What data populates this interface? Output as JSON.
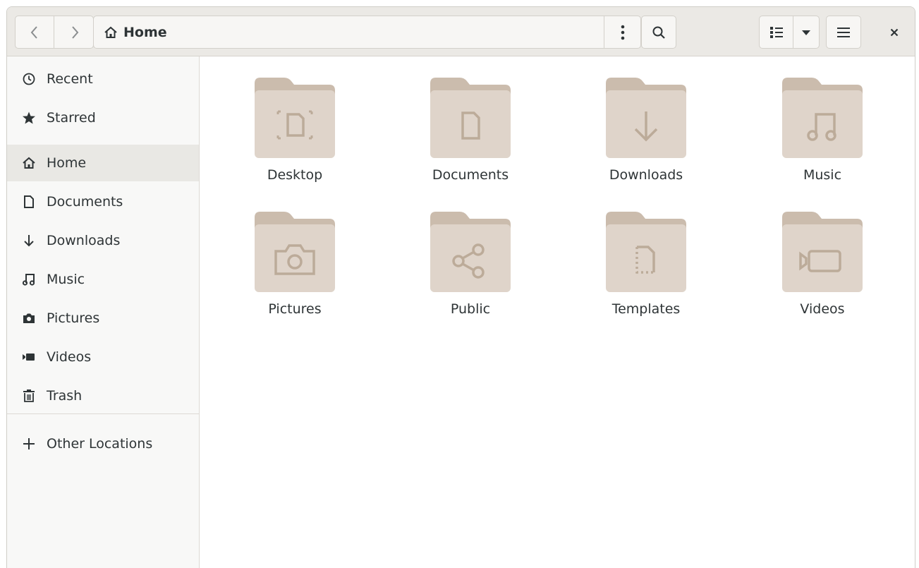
{
  "header": {
    "location_label": "Home",
    "icons": [
      "go-back-icon",
      "go-forward-icon",
      "home-icon",
      "kebab-menu-icon",
      "search-icon",
      "list-view-icon",
      "dropdown-arrow-icon",
      "hamburger-menu-icon",
      "close-icon"
    ]
  },
  "sidebar": {
    "items": [
      {
        "label": "Recent",
        "icon": "clock-icon"
      },
      {
        "label": "Starred",
        "icon": "star-icon"
      },
      {
        "label": "Home",
        "icon": "home-icon"
      },
      {
        "label": "Documents",
        "icon": "document-icon"
      },
      {
        "label": "Downloads",
        "icon": "download-arrow-icon"
      },
      {
        "label": "Music",
        "icon": "music-note-icon"
      },
      {
        "label": "Pictures",
        "icon": "camera-icon"
      },
      {
        "label": "Videos",
        "icon": "video-icon"
      },
      {
        "label": "Trash",
        "icon": "trash-icon"
      }
    ],
    "active": "Home",
    "other_locations": {
      "label": "Other Locations",
      "icon": "plus-icon"
    }
  },
  "folders": [
    {
      "label": "Desktop",
      "emblem": "desktop-icon"
    },
    {
      "label": "Documents",
      "emblem": "document-icon"
    },
    {
      "label": "Downloads",
      "emblem": "download-arrow-icon"
    },
    {
      "label": "Music",
      "emblem": "music-note-icon"
    },
    {
      "label": "Pictures",
      "emblem": "camera-icon"
    },
    {
      "label": "Public",
      "emblem": "share-icon"
    },
    {
      "label": "Templates",
      "emblem": "template-icon"
    },
    {
      "label": "Videos",
      "emblem": "video-icon"
    }
  ],
  "colors": {
    "folder_back": "#cbbcad",
    "folder_front": "#dfd4ca",
    "folder_emblem": "#bcab99",
    "headerbar": "#ebe9e5",
    "sidebar": "#f8f8f7",
    "sidebar_active": "#e9e8e4",
    "text": "#2e3436"
  }
}
